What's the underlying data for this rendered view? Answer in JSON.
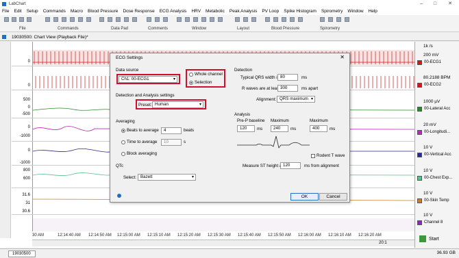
{
  "window": {
    "title": "LabChart"
  },
  "menu": [
    "File",
    "Edit",
    "Setup",
    "Commands",
    "Macro",
    "Blood Pressure",
    "Dose Response",
    "ECG Analysis",
    "HRV",
    "Metabolic",
    "Peak Analysis",
    "PV Loop",
    "Spike Histogram",
    "Spirometry",
    "Window",
    "Help"
  ],
  "toolbar_groups": [
    "File",
    "Commands",
    "Data Pad",
    "Comments",
    "Window",
    "Layout",
    "Blood Pressure",
    "Spirometry"
  ],
  "doc_tab": {
    "title": "19030500: Chart View (Playback File)*"
  },
  "channels": [
    {
      "range": "200 mV",
      "name": "00-ECG1",
      "color": "#cc1a1a"
    },
    {
      "range": "80.2188 BPM",
      "name": "00-ECG2",
      "color": "#cc1a1a"
    },
    {
      "range": "1000 µV",
      "name": "00-Lateral Acc",
      "color": "#2a8a2a"
    },
    {
      "range": "20 mV",
      "name": "00-Longitudi...",
      "color": "#b82ab8"
    },
    {
      "range": "10 V",
      "name": "00-Vertical Acc",
      "color": "#2a2a90"
    },
    {
      "range": "10 V",
      "name": "00-Chest Exp...",
      "color": "#58c08a"
    },
    {
      "range": "10 V",
      "name": "00-Skin Temp",
      "color": "#c08030"
    },
    {
      "range": "10 V",
      "name": "Channel 8",
      "color": "#8a2ab8"
    }
  ],
  "rate": "1k /s",
  "y_labels": [
    "0",
    "0",
    "500",
    "0",
    "-500",
    "0",
    "-1000",
    "0",
    "-1000",
    "800",
    "600",
    "31.6",
    "31",
    "30.6"
  ],
  "time_ticks": [
    "30 AM",
    "12:14:40 AM",
    "12:14:50 AM",
    "12:15:00 AM",
    "12:15:10 AM",
    "12:15:20 AM",
    "12:15:30 AM",
    "12:15:40 AM",
    "12:15:50 AM",
    "12:16:00 AM",
    "12:16:10 AM",
    "12:16:20 AM"
  ],
  "zoom": "20:1",
  "start_label": "Start",
  "statusbar": {
    "file_tab": "19030500",
    "disk": "36.93 GB"
  },
  "dialog": {
    "title": "ECG Settings",
    "data_source_label": "Data source",
    "channel_value": "Ch1: 00-ECG1",
    "whole_channel": "Whole channel",
    "selection": "Selection",
    "detection_settings_label": "Detection and Analysis settings",
    "preset_label": "Preset:",
    "preset_value": "Human",
    "averaging_label": "Averaging",
    "beats_to_average": "Beats to average",
    "beats_value": "4",
    "beats_unit": "beats",
    "time_to_average": "Time to average",
    "time_value": "10",
    "time_unit": "s",
    "block_averaging": "Block averaging",
    "qtc_label": "QTc",
    "select_label": "Select:",
    "select_value": "Bazett",
    "detection_label": "Detection",
    "qrs_width_label": "Typical QRS width is",
    "qrs_width_value": "80",
    "qrs_width_unit": "ms",
    "rwaves_label": "R waves are at least",
    "rwaves_value": "300",
    "rwaves_unit": "ms apart",
    "alignment_label": "Alignment:",
    "alignment_value": "QRS maximum",
    "analysis_label": "Analysis",
    "prep_baseline": "Pre-P baseline",
    "maximum1": "Maximum",
    "maximum2": "Maximum",
    "prep_value": "120",
    "max1_value": "240",
    "max2_value": "400",
    "ms": "ms",
    "rodent_t": "Rodent T wave",
    "st_label": "Measure ST height at",
    "st_value": "120",
    "st_unit": "ms from alignment",
    "ok": "OK",
    "cancel": "Cancel"
  }
}
